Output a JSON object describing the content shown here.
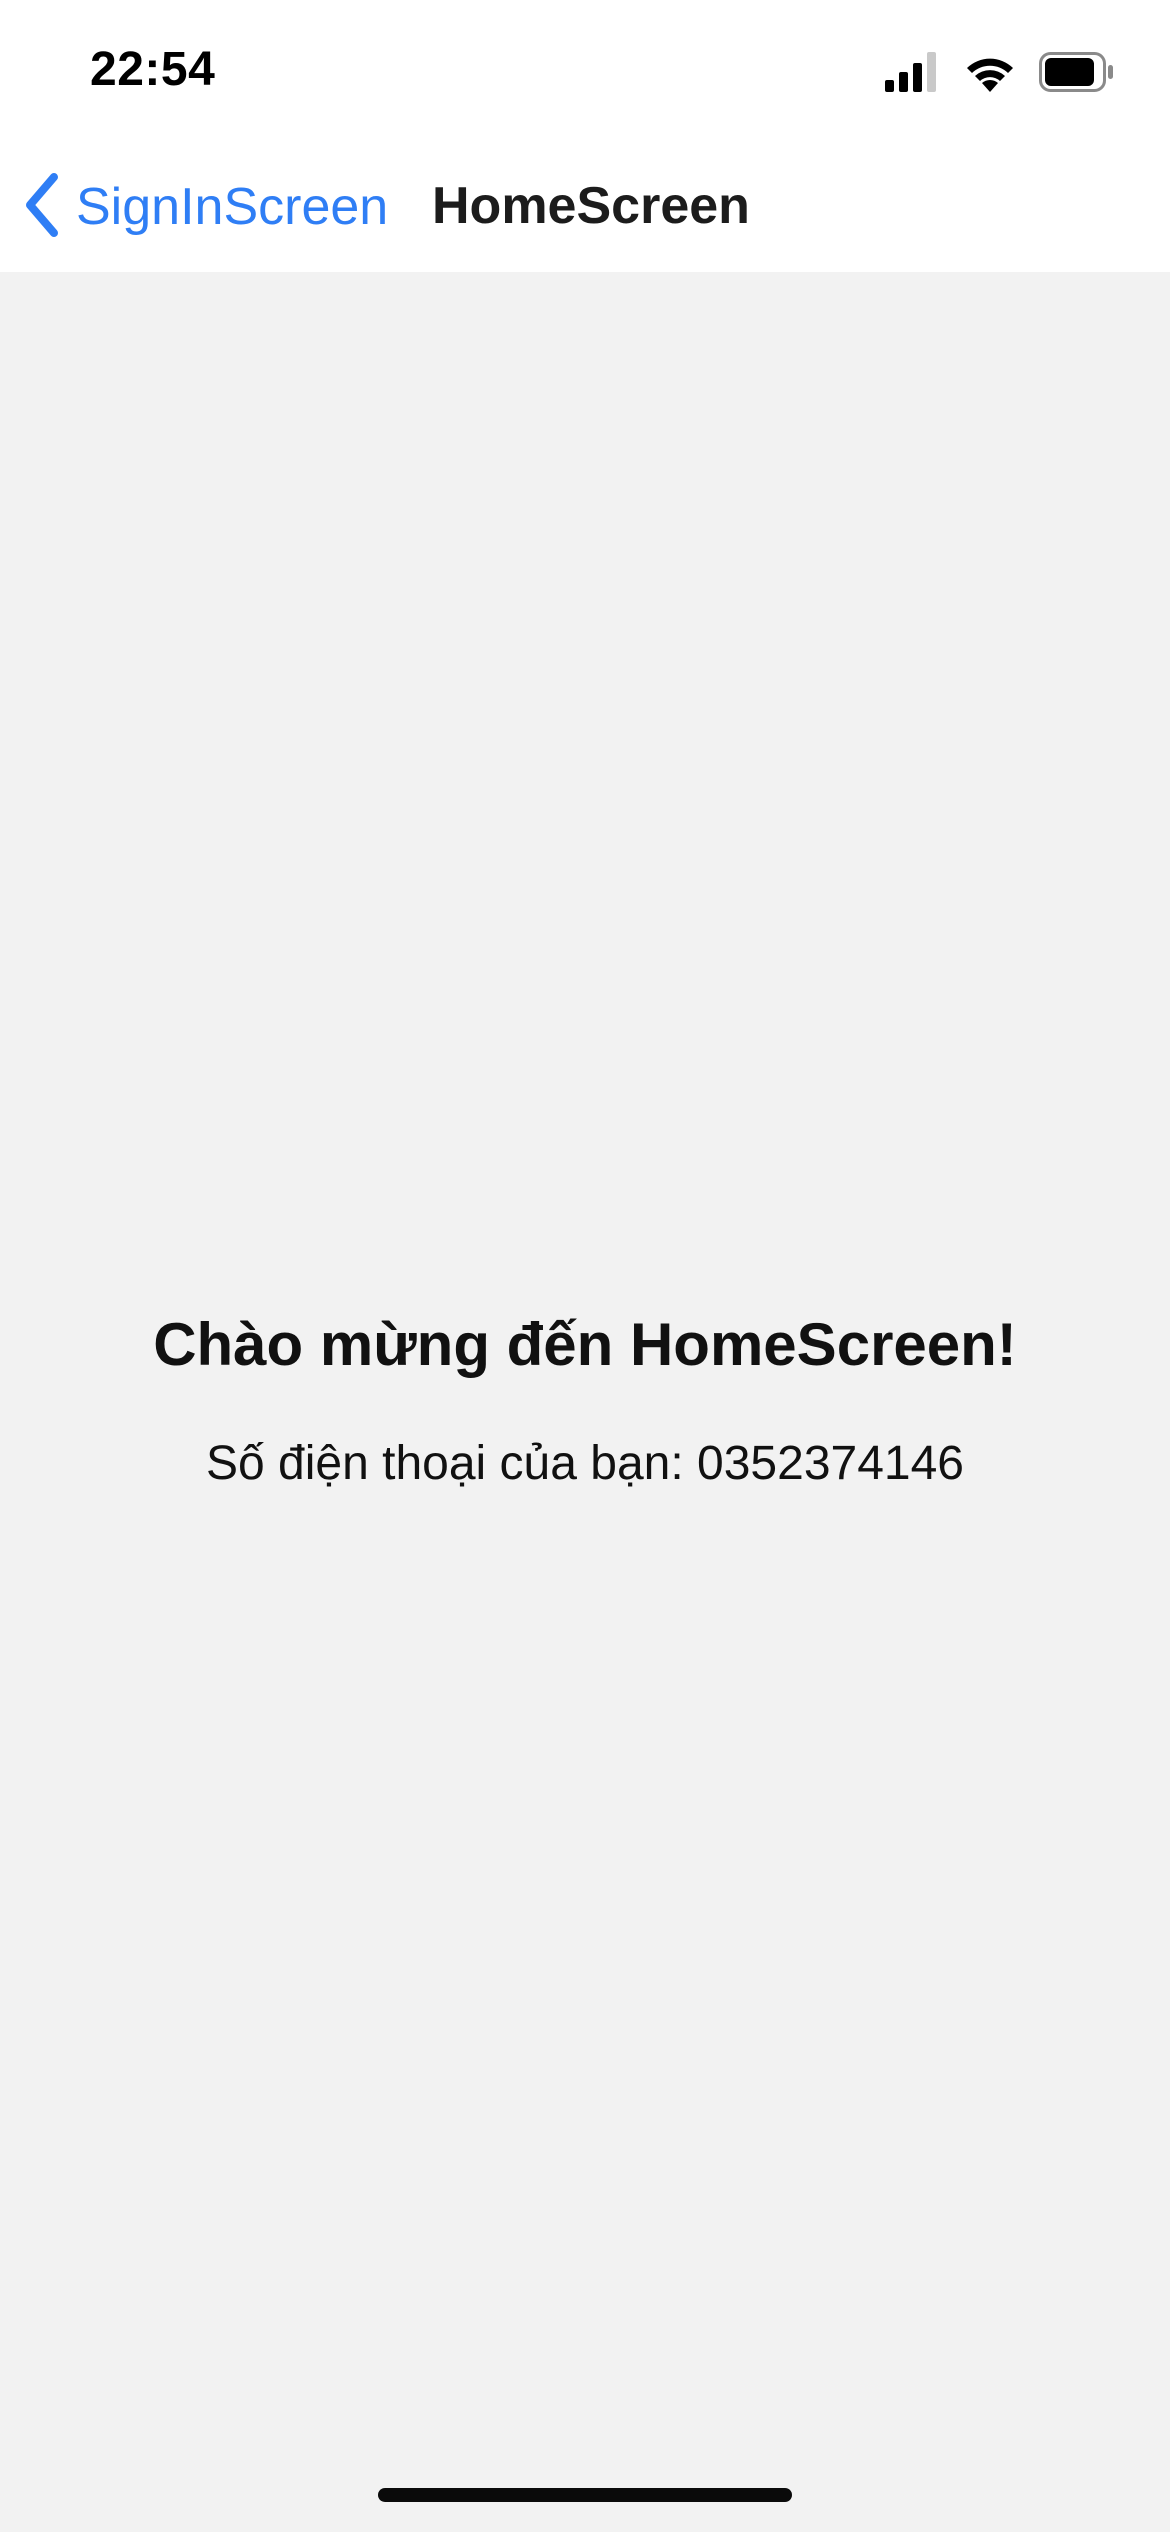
{
  "status_bar": {
    "time": "22:54",
    "icons": [
      "cellular-signal-icon",
      "wifi-icon",
      "battery-icon"
    ]
  },
  "nav_bar": {
    "back_label": "SignInScreen",
    "title": "HomeScreen",
    "accent_color": "#2f7ef5"
  },
  "main": {
    "welcome_title": "Chào mừng đến HomeScreen!",
    "phone_text": "Số điện thoại của bạn: 0352374146"
  }
}
